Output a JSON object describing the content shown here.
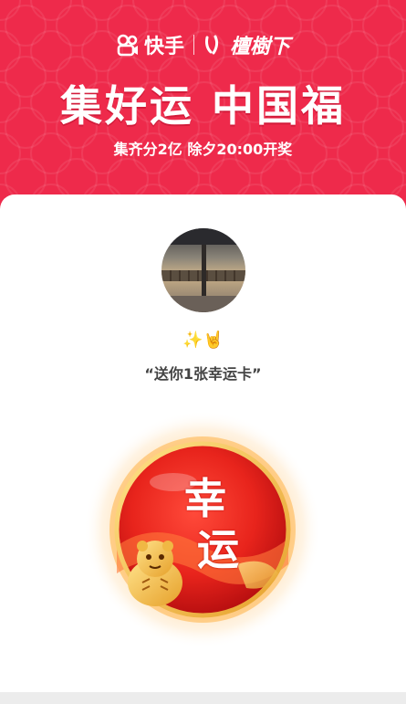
{
  "banner": {
    "brand_name": "快手",
    "partner_name": "檀樹下",
    "headline": "集好运 中国福",
    "subline": "集齐分2亿 除夕20:00开奖",
    "color": "#ee2a4b"
  },
  "card": {
    "emoji": "✨🤘",
    "quote": "“送你1张幸运卡”",
    "lucky_card": {
      "char1": "幸",
      "char2": "运"
    }
  },
  "icons": {
    "brand": "kuaishou-logo-icon",
    "partner": "partner-logo-icon"
  }
}
